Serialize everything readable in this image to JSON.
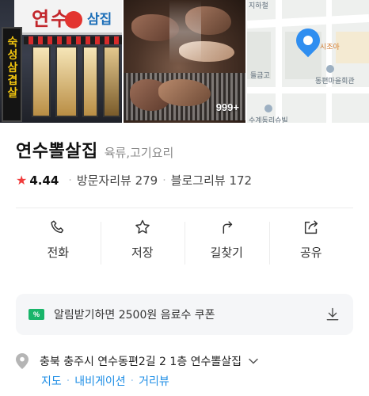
{
  "photos": {
    "storefront_sign": "연수",
    "storefront_sign_right": "삼집",
    "vertical_sign": "숙성삼겹살",
    "photo_count": "999+",
    "map": {
      "label_top": "지하철",
      "label_store": "시조아",
      "label_school": "들금고",
      "label_hall": "동편마을회관",
      "label_bottom": "수계동리슈빌"
    }
  },
  "place": {
    "name": "연수뽈살집",
    "category": "육류,고기요리",
    "rating": "4.44",
    "visitor_reviews": "방문자리뷰 279",
    "blog_reviews": "블로그리뷰 172"
  },
  "actions": [
    {
      "label": "전화",
      "icon": "phone-icon"
    },
    {
      "label": "저장",
      "icon": "star-icon"
    },
    {
      "label": "길찾기",
      "icon": "directions-icon"
    },
    {
      "label": "공유",
      "icon": "share-icon"
    }
  ],
  "coupon": {
    "badge": "%",
    "text": "알림받기하면 2500원 음료수 쿠폰"
  },
  "address": {
    "text": "충북 충주시 연수동편2길 2 1층 연수뽈살집",
    "links": [
      "지도",
      "내비게이션",
      "거리뷰"
    ]
  },
  "colors": {
    "star": "#f03c3c",
    "link": "#1e8ee6",
    "coupon_badge": "#19b56a",
    "map_pin": "#2f8ef0"
  }
}
